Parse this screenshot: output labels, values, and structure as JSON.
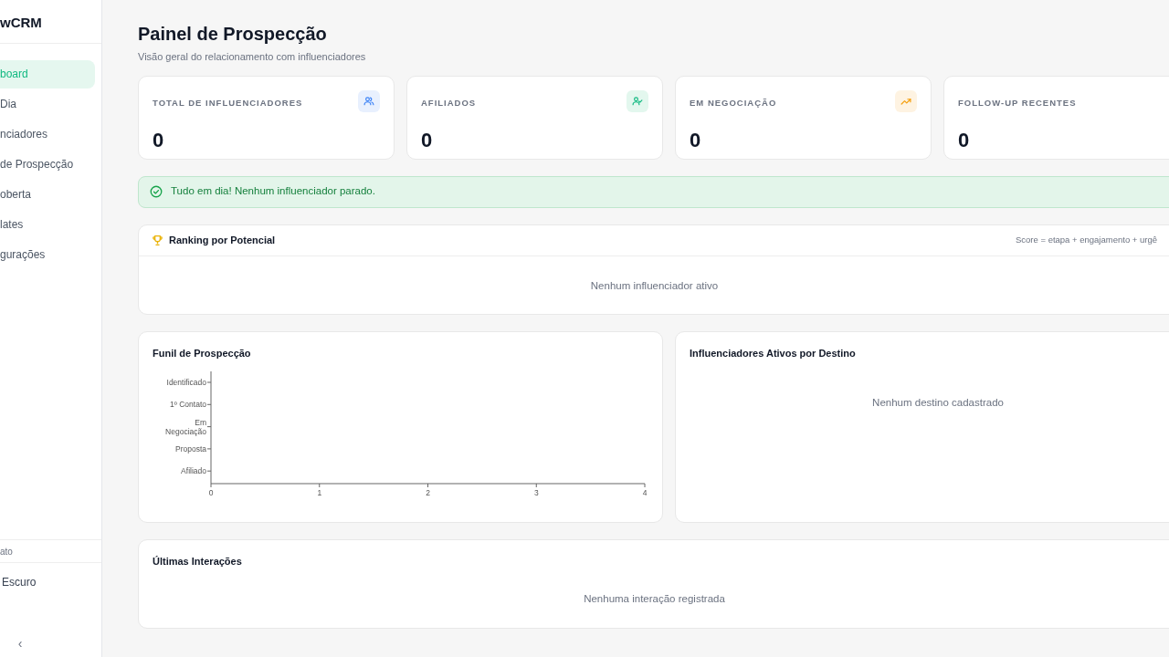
{
  "sidebar": {
    "brand": "wCRM",
    "items": [
      {
        "label": "board",
        "selected": true
      },
      {
        "label": "Dia",
        "selected": false
      },
      {
        "label": "nciadores",
        "selected": false
      },
      {
        "label": "de Prospecção",
        "selected": false
      },
      {
        "label": "oberta",
        "selected": false
      },
      {
        "label": "lates",
        "selected": false
      },
      {
        "label": "gurações",
        "selected": false
      }
    ],
    "footer_label": "ato",
    "theme_toggle": "Escuro",
    "collapse": "‹"
  },
  "header": {
    "title": "Painel de Prospecção",
    "subtitle": "Visão geral do relacionamento com influenciadores"
  },
  "stats": [
    {
      "label": "TOTAL DE INFLUENCIADORES",
      "value": "0",
      "kind": "users"
    },
    {
      "label": "AFILIADOS",
      "value": "0",
      "kind": "user-check"
    },
    {
      "label": "EM NEGOCIAÇÃO",
      "value": "0",
      "kind": "trending"
    },
    {
      "label": "FOLLOW-UP RECENTES",
      "value": "0",
      "kind": "none"
    }
  ],
  "alert": {
    "kind": "success",
    "text": "Tudo em dia! Nenhum influenciador parado."
  },
  "ranking": {
    "title": "Ranking por Potencial",
    "note": "Score = etapa + engajamento + urgê",
    "empty": "Nenhum influenciador ativo"
  },
  "funnel": {
    "title": "Funil de Prospecção",
    "chart_data": {
      "type": "bar",
      "orientation": "horizontal",
      "categories": [
        "Identificado",
        "1º Contato",
        "Em Negociação",
        "Proposta",
        "Afiliado"
      ],
      "values": [
        0,
        0,
        0,
        0,
        0
      ],
      "xlim": [
        0,
        4
      ],
      "xticks": [
        0,
        1,
        2,
        3,
        4
      ]
    }
  },
  "destinations": {
    "title": "Influenciadores Ativos por Destino",
    "empty": "Nenhum destino cadastrado"
  },
  "interactions": {
    "title": "Últimas Interações",
    "empty": "Nenhuma interação registrada"
  }
}
